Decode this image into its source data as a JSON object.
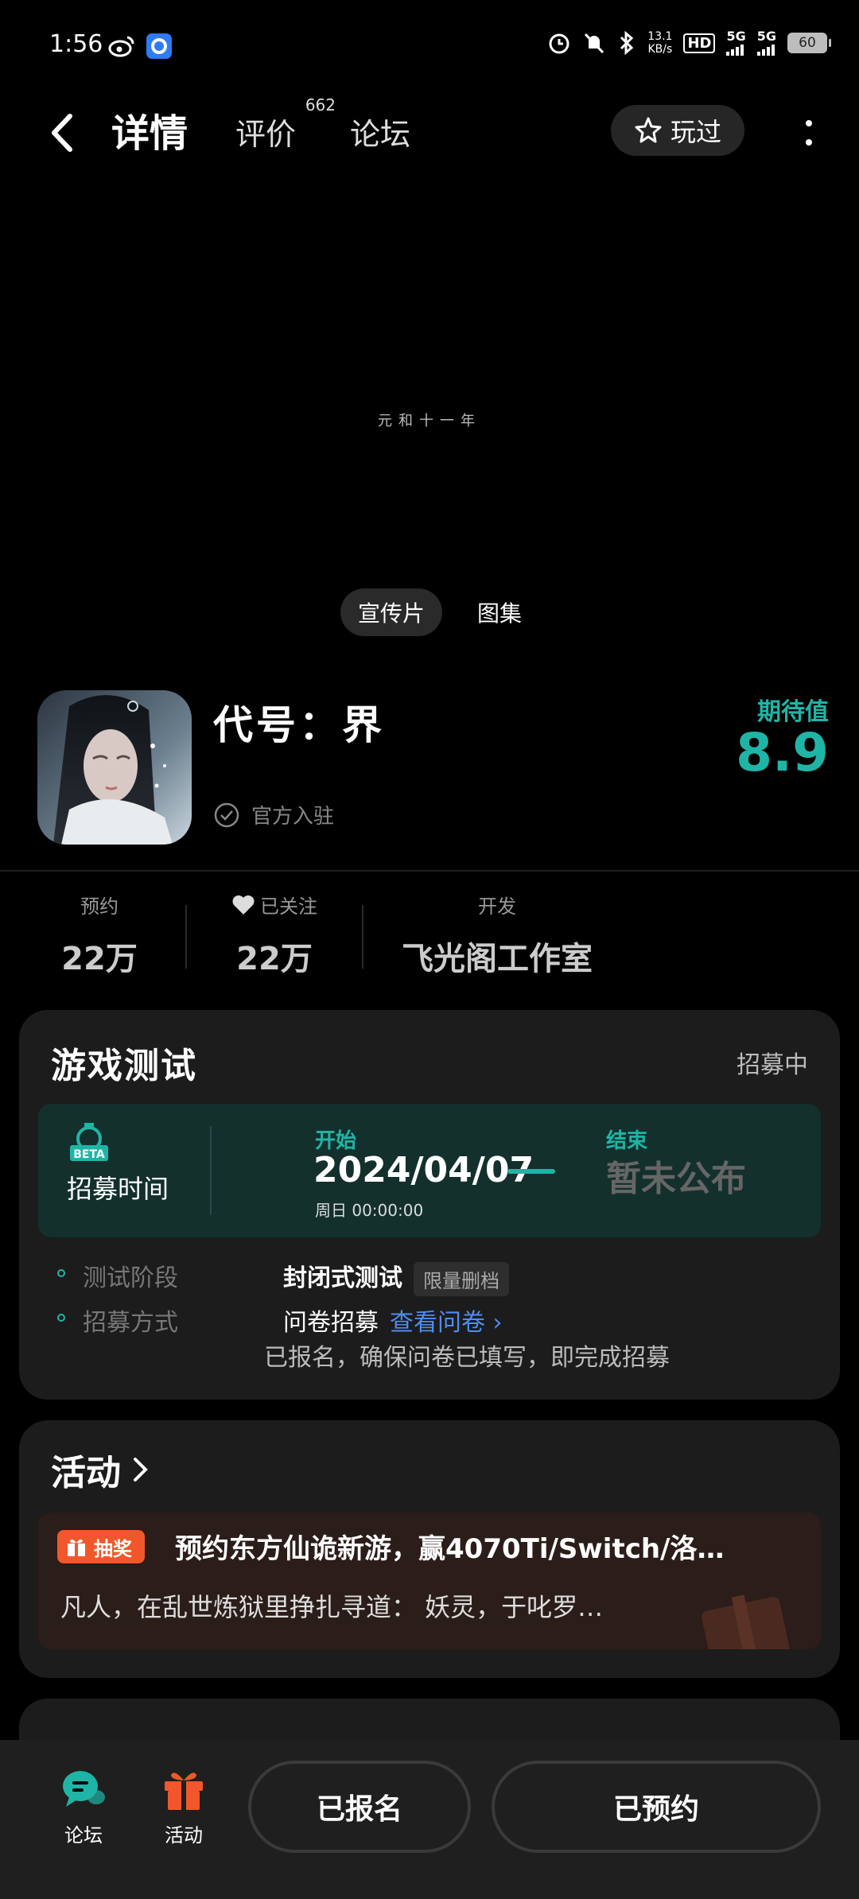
{
  "status": {
    "time": "1:56",
    "net_speed_value": "13.1",
    "net_speed_unit": "KB/s",
    "hd": "HD",
    "sim1": "5G",
    "sim2": "5G",
    "battery": "60"
  },
  "nav": {
    "tabs": [
      {
        "label": "详情"
      },
      {
        "label": "评价",
        "badge": "662"
      },
      {
        "label": "论坛"
      }
    ],
    "played_label": "玩过"
  },
  "video": {
    "caption": "元和十一年",
    "media_options": [
      "宣传片",
      "图集"
    ]
  },
  "game": {
    "title": "代号：界",
    "official_label": "官方入驻",
    "expect_label": "期待值",
    "expect_score": "8.9"
  },
  "stats": [
    {
      "label": "预约",
      "value": "22万"
    },
    {
      "label": "已关注",
      "value": "22万"
    },
    {
      "label": "开发",
      "value": "飞光阁工作室"
    }
  ],
  "test_card": {
    "title": "游戏测试",
    "status": "招募中",
    "recruit_label": "招募时间",
    "start_label": "开始",
    "start_date": "2024/04/07",
    "start_time": "周日 00:00:00",
    "end_label": "结束",
    "end_value": "暂未公布",
    "rows": [
      {
        "key": "测试阶段",
        "value": "封闭式测试",
        "tag": "限量删档"
      },
      {
        "key": "招募方式",
        "value": "问卷招募",
        "link": "查看问卷"
      }
    ],
    "note": "已报名，确保问卷已填写，即完成招募"
  },
  "activity": {
    "title": "活动",
    "badge": "抽奖",
    "headline": "预约东方仙诡新游，赢4070Ti/Switch/洛…",
    "desc": "凡人，在乱世炼狱里挣扎寻道： 妖灵，于叱罗…"
  },
  "bottom": {
    "forum_label": "论坛",
    "activity_label": "活动",
    "registered_label": "已报名",
    "reserved_label": "已预约"
  },
  "colors": {
    "accent": "#1fb5a6",
    "activity_badge": "#f2572b",
    "link": "#4e8df0"
  }
}
